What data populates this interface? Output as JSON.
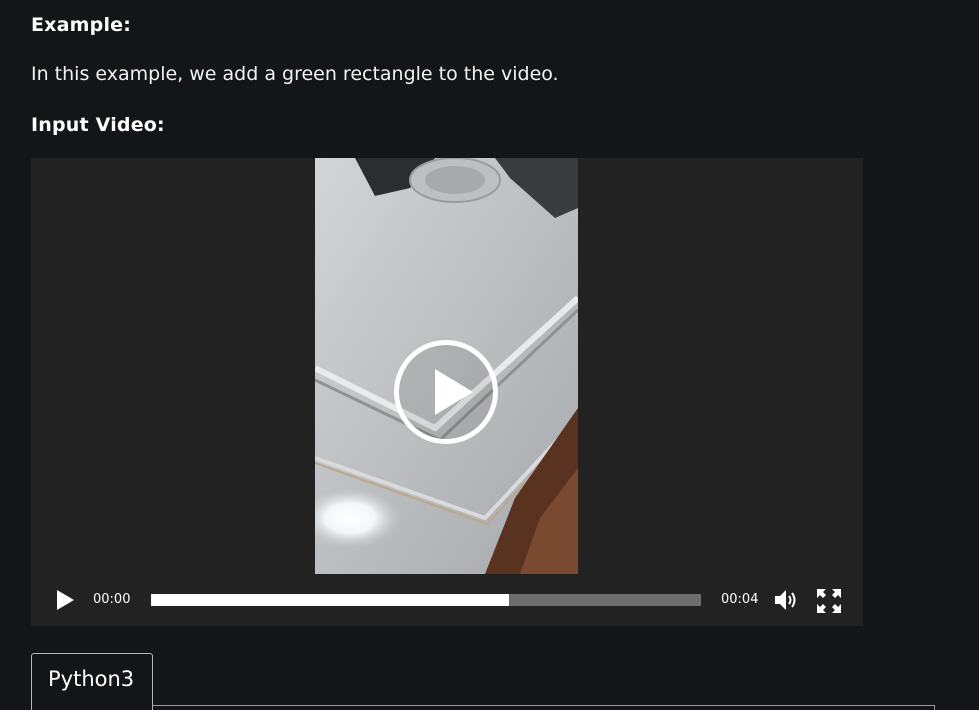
{
  "example_heading": "Example:",
  "description": "In this example, we add a green rectangle to the video.",
  "input_heading": "Input Video:",
  "video": {
    "current_time": "00:00",
    "duration": "00:04",
    "progress": 0.65,
    "play_icon": "play-icon",
    "volume_icon": "volume-icon",
    "fullscreen_icon": "fullscreen-icon"
  },
  "code_tabs": [
    {
      "label": "Python3",
      "active": true
    }
  ],
  "colors": {
    "page_background": "#141518",
    "player_background": "#222222",
    "progress_fill": "#ffffff",
    "progress_track": "#6e6e6e"
  }
}
